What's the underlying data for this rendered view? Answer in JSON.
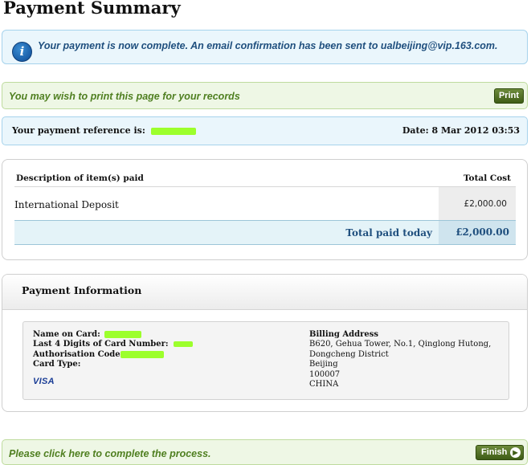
{
  "page": {
    "title": "Payment Summary"
  },
  "info": {
    "icon": "info-icon",
    "icon_glyph": "i",
    "message": "Your payment is now complete. An email confirmation has been sent to ualbeijing@vip.163.com."
  },
  "print_bar": {
    "message": "You may wish to print this page for your records",
    "button_label": "Print"
  },
  "reference": {
    "label": "Your payment reference is:",
    "date_text": "Date: 8 Mar 2012 03:53"
  },
  "items": {
    "header_description": "Description of item(s) paid",
    "header_cost": "Total Cost",
    "rows": [
      {
        "name": "International Deposit",
        "cost": "£2,000.00"
      }
    ],
    "total_label": "Total paid today",
    "total_value": "£2,000.00"
  },
  "payment_info": {
    "title": "Payment Information",
    "name_on_card_label": "Name on Card:",
    "last4_label": "Last 4 Digits of Card Number:",
    "auth_code_label": "Authorisation Code",
    "card_type_label": "Card Type:",
    "card_type_value": "VISA",
    "billing_address_label": "Billing Address",
    "billing_address_lines": [
      "B620, Gehua Tower, No.1, Qinglong Hutong,",
      "Dongcheng District",
      "Beijing",
      "100007",
      "CHINA"
    ]
  },
  "finish_bar": {
    "message": "Please click here to complete the process.",
    "button_label": "Finish",
    "button_icon": "arrow-right-icon"
  },
  "colors": {
    "info_bg": "#eaf6fc",
    "success_bg": "#eef7e5",
    "button_green": "#4a6a1f",
    "redaction": "#9cff2c",
    "heading_blue": "#1f4f7e"
  }
}
